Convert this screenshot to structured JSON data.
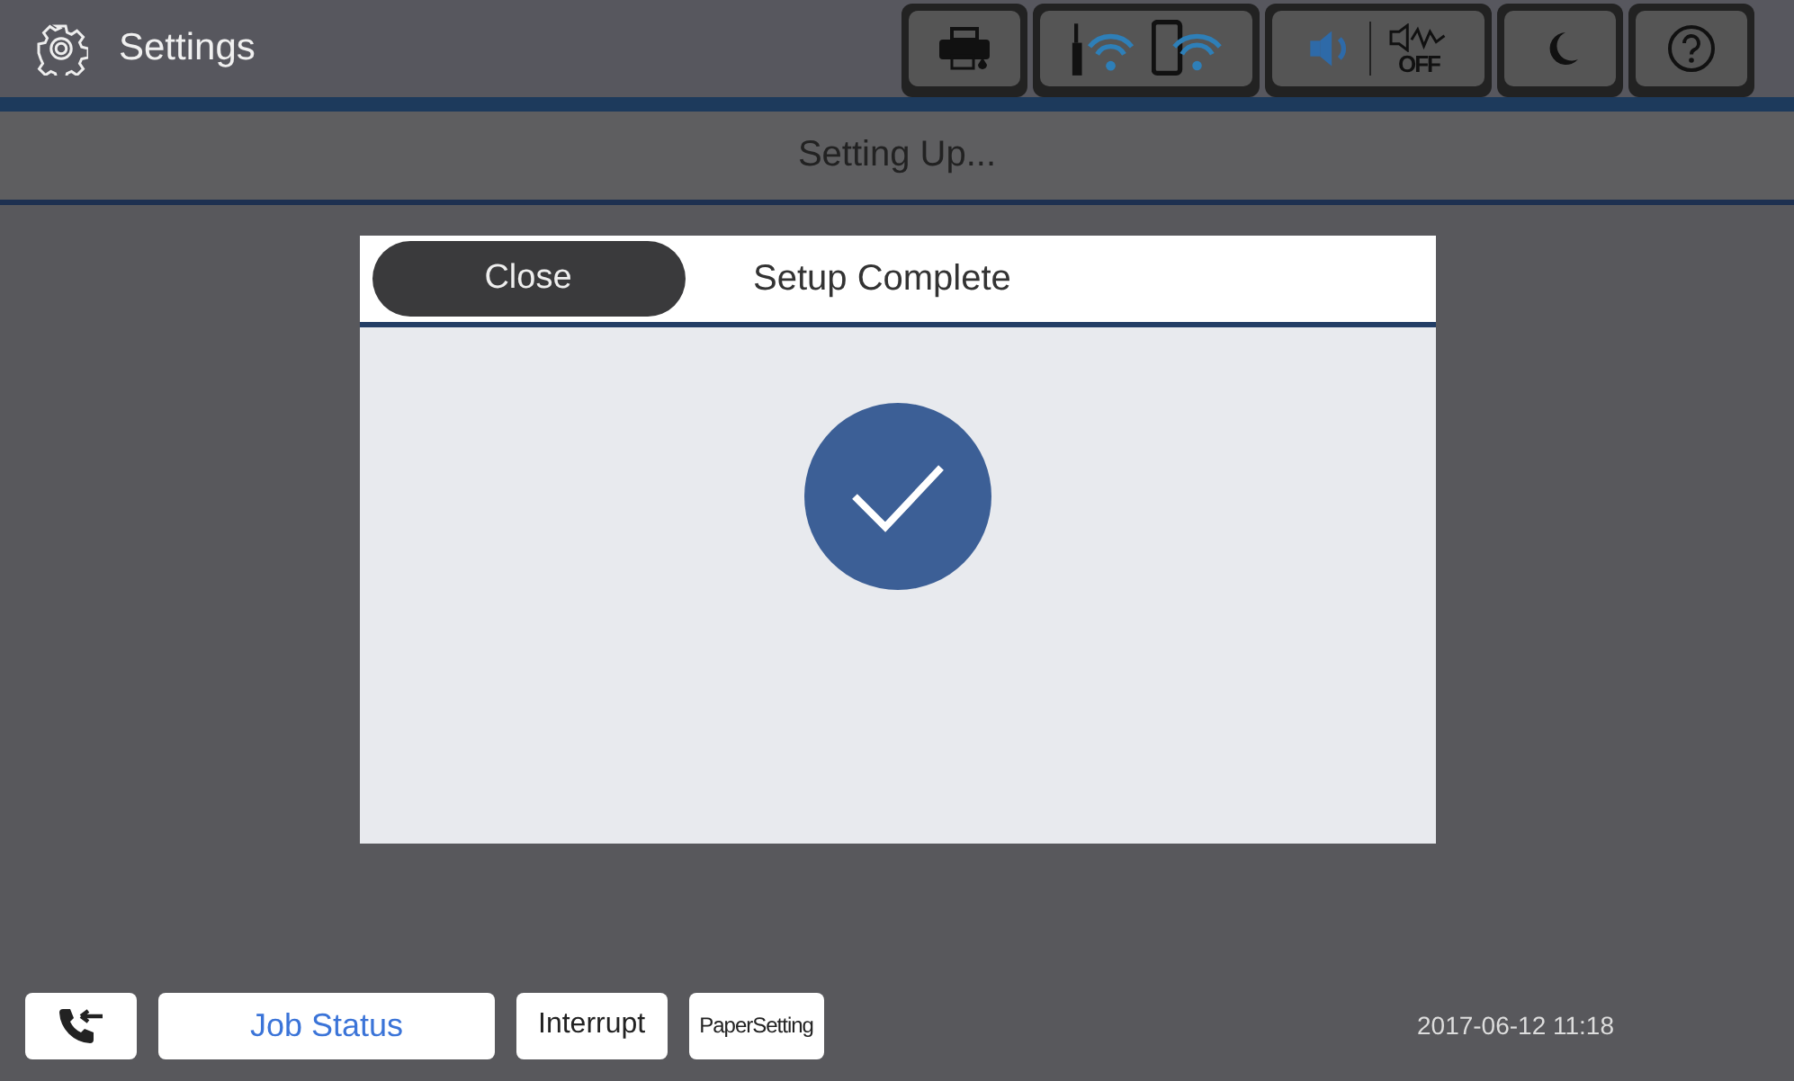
{
  "header": {
    "title": "Settings",
    "sound_off_label": "OFF"
  },
  "subheader": {
    "title": "Setting Up..."
  },
  "dialog": {
    "close_label": "Close",
    "title": "Setup Complete"
  },
  "footer": {
    "job_status": "Job Status",
    "interrupt": "Interrupt",
    "paper_setting": "PaperSetting",
    "datetime": "2017-06-12 11:18"
  }
}
